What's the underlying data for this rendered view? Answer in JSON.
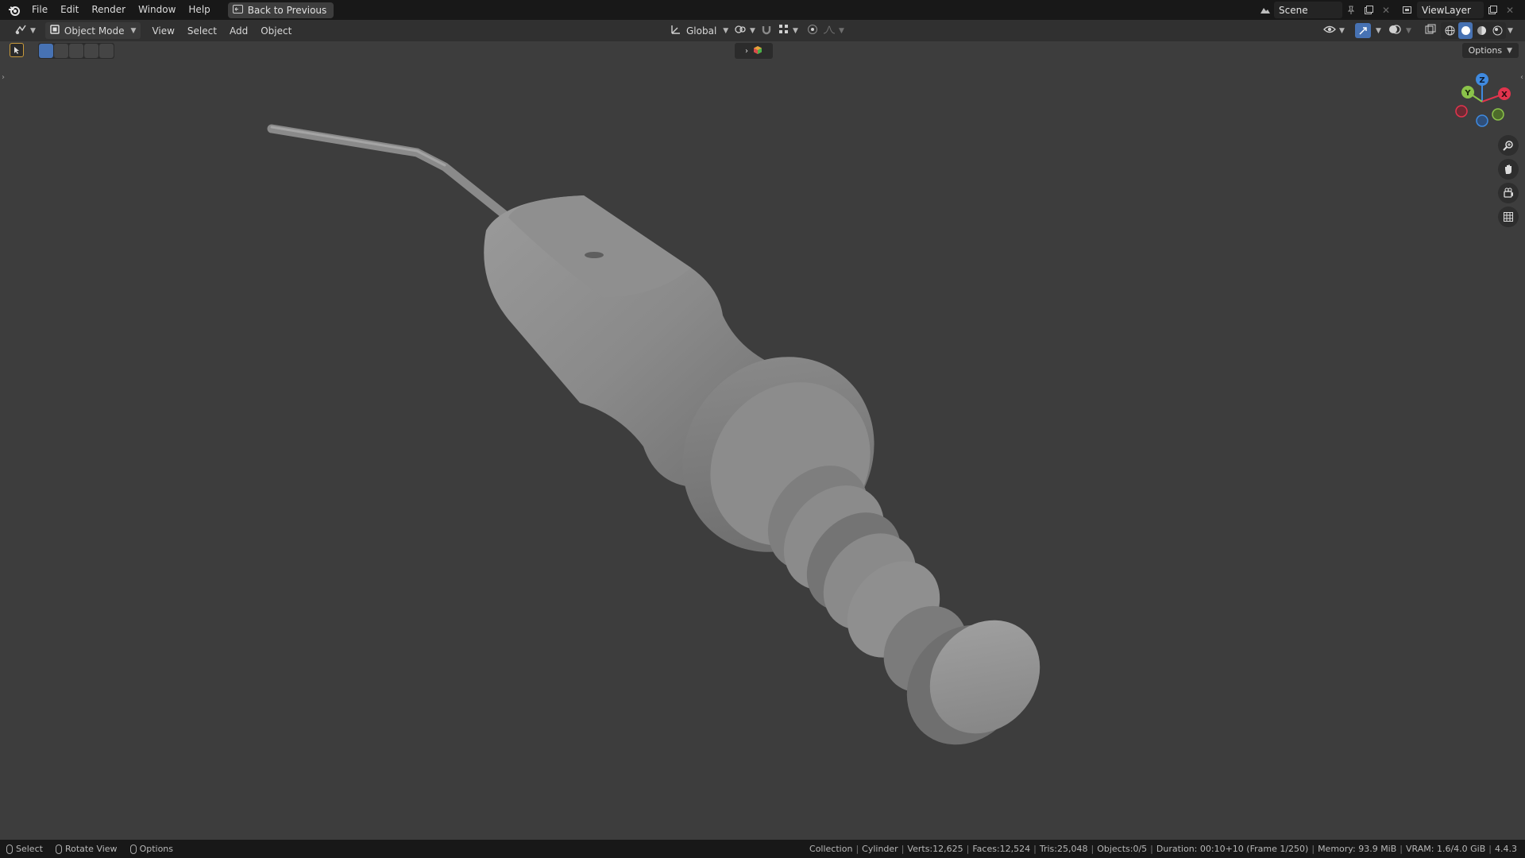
{
  "menu": {
    "items": [
      "File",
      "Edit",
      "Render",
      "Window",
      "Help"
    ],
    "back_button": "Back to Previous"
  },
  "scene": {
    "label": "Scene"
  },
  "view_layer": {
    "label": "ViewLayer"
  },
  "header": {
    "mode": "Object Mode",
    "menus": [
      "View",
      "Select",
      "Add",
      "Object"
    ],
    "transform_orientation": "Global"
  },
  "viewport": {
    "options_label": "Options",
    "gizmo": {
      "x": "X",
      "y": "Y",
      "z": "Z"
    }
  },
  "statusbar": {
    "hints": [
      {
        "label": "Select",
        "icon": "mouse-left-icon"
      },
      {
        "label": "Rotate View",
        "icon": "mouse-middle-icon"
      },
      {
        "label": "Options",
        "icon": "mouse-right-icon"
      }
    ],
    "stats": {
      "collection": "Collection",
      "object": "Cylinder",
      "verts": "Verts:12,625",
      "faces": "Faces:12,524",
      "tris": "Tris:25,048",
      "objects": "Objects:0/5",
      "duration": "Duration: 00:10+10 (Frame 1/250)",
      "memory": "Memory: 93.9 MiB",
      "vram": "VRAM: 1.6/4.0 GiB",
      "version": "4.4.3"
    }
  },
  "colors": {
    "accent": "#4772b3",
    "viewport_bg": "#3d3d3d",
    "axis_x": "#e2344d",
    "axis_y": "#8bc34a",
    "axis_z": "#3f8ae0"
  }
}
